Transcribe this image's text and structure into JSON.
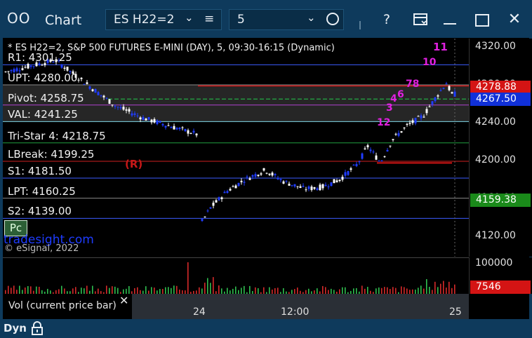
{
  "window": {
    "icon": "OO",
    "title": "Chart",
    "symbol_field": "ES H22=2",
    "interval_field": "5",
    "help_label": "?"
  },
  "chart": {
    "header": "* ES H22=2, S&P 500 FUTURES E-MINI (DAY), 5, 09:30-16:15 (Dynamic)",
    "levels": [
      {
        "label": "R1: 4301.25",
        "price": 4301.25,
        "color": "#3b5bff"
      },
      {
        "label": "UPT: 4280.00",
        "price": 4280.0,
        "color": "#8a8a8a"
      },
      {
        "label": "Pivot: 4258.75",
        "price": 4258.75,
        "color": "#b040d0"
      },
      {
        "label": "VAL: 4241.25",
        "price": 4241.25,
        "color": "#7fd8e8"
      },
      {
        "label": "Tri-Star 4: 4218.75",
        "price": 4218.75,
        "color": "#20a040"
      },
      {
        "label": "LBreak: 4199.25",
        "price": 4199.25,
        "color": "#d02020"
      },
      {
        "label": "S1: 4181.50",
        "price": 4181.5,
        "color": "#3b5bff"
      },
      {
        "label": "LPT: 4160.25",
        "price": 4160.25,
        "color": "#8a8a8a"
      },
      {
        "label": "S2: 4139.00",
        "price": 4139.0,
        "color": "#3b5bff"
      }
    ],
    "price_ticks": [
      {
        "label": "4320.00",
        "price": 4320
      },
      {
        "label": "4280.00",
        "price": 4280
      },
      {
        "label": "4240.00",
        "price": 4240
      },
      {
        "label": "4200.00",
        "price": 4200
      },
      {
        "label": "4160.00",
        "price": 4160
      },
      {
        "label": "4120.00",
        "price": 4120
      }
    ],
    "price_markers": [
      {
        "label": "4278.88",
        "bg": "#d41414"
      },
      {
        "label": "4267.50",
        "bg": "#1030d8"
      },
      {
        "label": "4159.38",
        "bg": "#1a8a1a"
      }
    ],
    "time_ticks": [
      "24",
      "12:00",
      "25"
    ],
    "annotations": {
      "r_marker": "(R)",
      "watermark": "tradesight.com",
      "copyright": "© eSignal, 2022",
      "pc_button": "Pc",
      "counts": [
        "11",
        "10",
        "78",
        "6",
        "4",
        "3",
        "12"
      ]
    }
  },
  "volume": {
    "axis_label": "100000",
    "current_value": "7546",
    "legend": "Vol (current price bar)"
  },
  "status": {
    "label": "Dyn"
  },
  "colors": {
    "frame": "#0e3a5c",
    "bull": "#ffffff",
    "bear": "#1f3cff"
  }
}
